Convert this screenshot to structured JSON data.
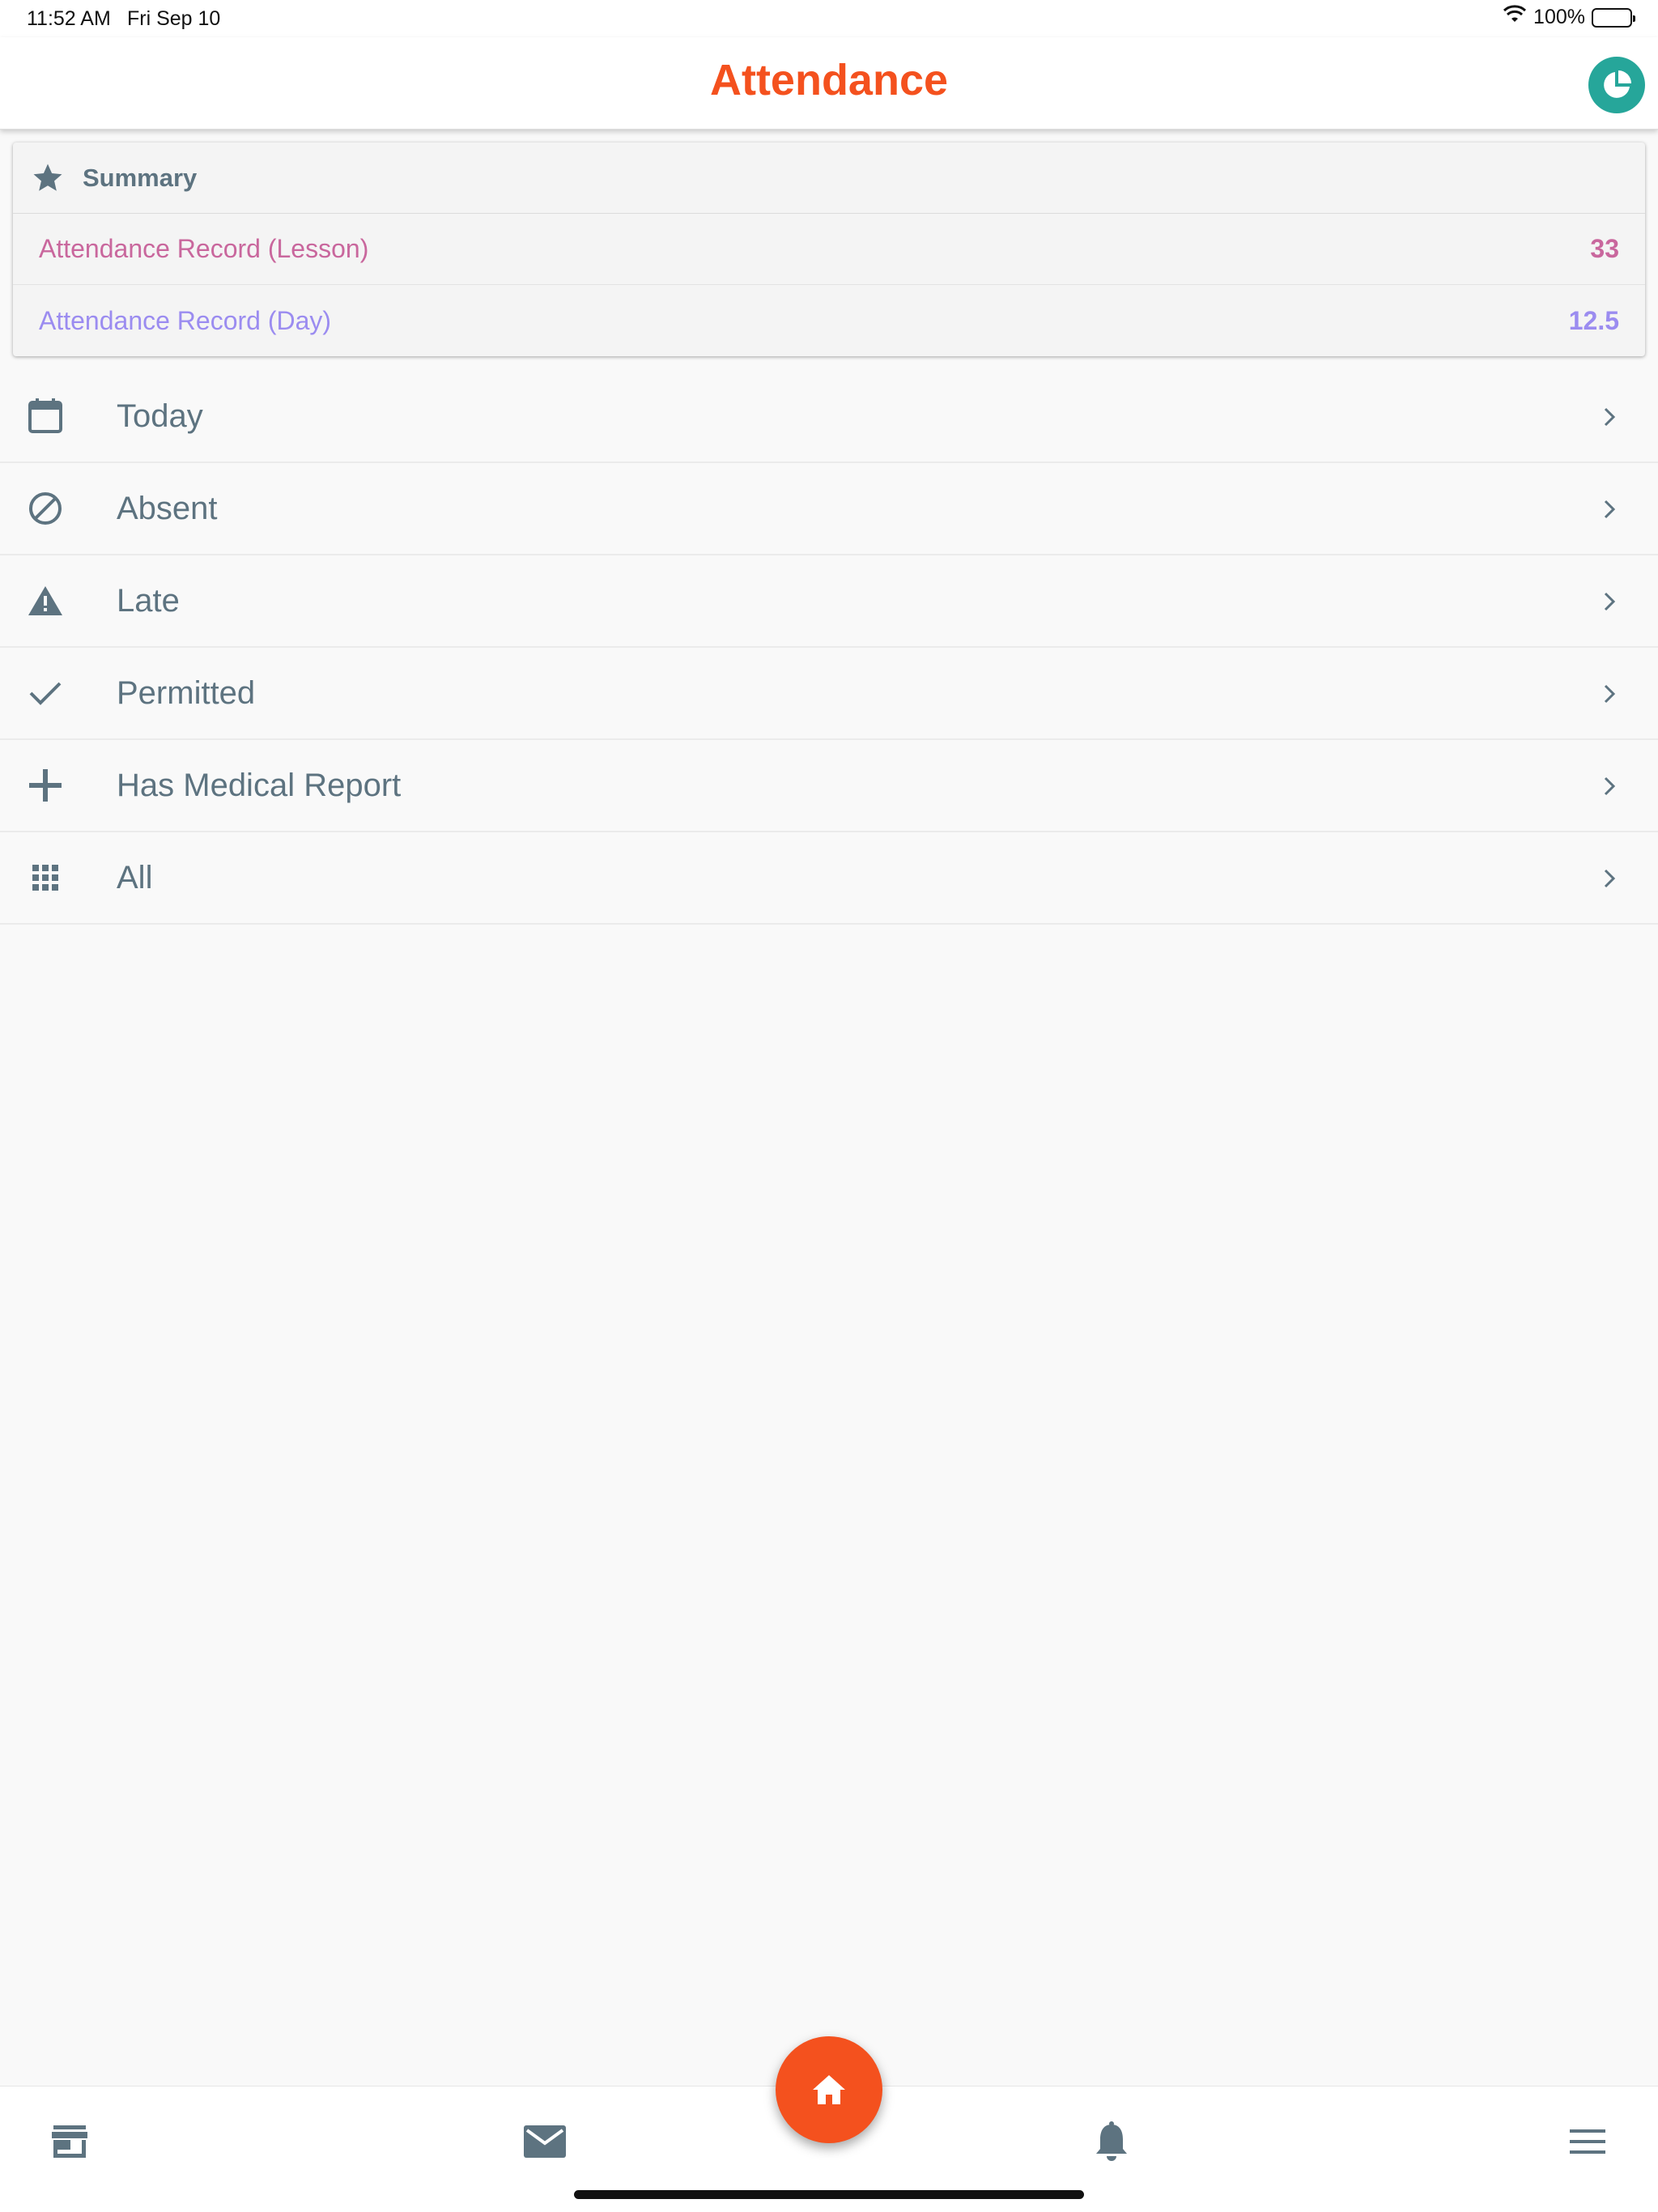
{
  "status_bar": {
    "time": "11:52 AM",
    "date": "Fri Sep 10",
    "battery": "100%",
    "icons": [
      "wifi-icon",
      "battery-icon"
    ]
  },
  "header": {
    "title": "Attendance",
    "action_icon": "pie-chart-icon"
  },
  "summary": {
    "title": "Summary",
    "icon": "star-icon",
    "rows": [
      {
        "label": "Attendance Record (Lesson)",
        "value": "33",
        "color": "#c9679d"
      },
      {
        "label": "Attendance Record (Day)",
        "value": "12.5",
        "color": "#9b8cf0"
      }
    ]
  },
  "menu": {
    "items": [
      {
        "label": "Today",
        "icon": "calendar-icon"
      },
      {
        "label": "Absent",
        "icon": "block-icon"
      },
      {
        "label": "Late",
        "icon": "warning-icon"
      },
      {
        "label": "Permitted",
        "icon": "check-icon"
      },
      {
        "label": "Has Medical Report",
        "icon": "plus-icon"
      },
      {
        "label": "All",
        "icon": "grid-icon"
      }
    ]
  },
  "bottom_nav": {
    "items": [
      "store-icon",
      "mail-icon",
      "home-icon",
      "bell-icon",
      "menu-icon"
    ]
  },
  "colors": {
    "accent": "#f4511e",
    "teal": "#26a69a",
    "text": "#5d7380"
  }
}
